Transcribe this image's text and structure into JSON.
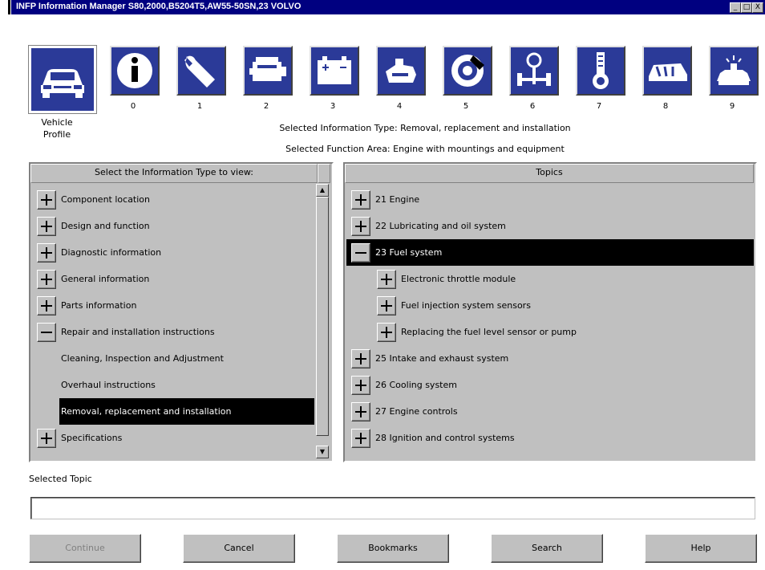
{
  "window": {
    "title": "INFP Information Manager S80,2000,B5204T5,AW55-50SN,23 VOLVO",
    "minimize": "_",
    "maximize": "□",
    "close": "X"
  },
  "icons": [
    {
      "name": "vehicle-profile-icon",
      "number": ""
    },
    {
      "name": "info-icon",
      "number": "0"
    },
    {
      "name": "wrench-icon",
      "number": "1"
    },
    {
      "name": "engine-icon",
      "number": "2"
    },
    {
      "name": "battery-icon",
      "number": "3"
    },
    {
      "name": "transmission-icon",
      "number": "4"
    },
    {
      "name": "brake-disc-icon",
      "number": "5"
    },
    {
      "name": "steering-axle-icon",
      "number": "6"
    },
    {
      "name": "suspension-spring-icon",
      "number": "7"
    },
    {
      "name": "body-interior-icon",
      "number": "8"
    },
    {
      "name": "emergency-vehicle-icon",
      "number": "9"
    }
  ],
  "vehicle_profile_label": "Vehicle Profile",
  "selected_info_type": "Selected Information Type: Removal, replacement and installation",
  "selected_function_area": "Selected Function Area: Engine with mountings and equipment",
  "left_panel": {
    "header": "Select the Information Type to view:",
    "items": [
      {
        "label": "Component location",
        "expander": "plus",
        "indent": 0,
        "selected": false
      },
      {
        "label": "Design and function",
        "expander": "plus",
        "indent": 0,
        "selected": false
      },
      {
        "label": "Diagnostic information",
        "expander": "plus",
        "indent": 0,
        "selected": false
      },
      {
        "label": "General information",
        "expander": "plus",
        "indent": 0,
        "selected": false
      },
      {
        "label": "Parts information",
        "expander": "plus",
        "indent": 0,
        "selected": false
      },
      {
        "label": "Repair and installation instructions",
        "expander": "minus",
        "indent": 0,
        "selected": false
      },
      {
        "label": "Cleaning, Inspection and Adjustment",
        "expander": "none",
        "indent": 1,
        "selected": false
      },
      {
        "label": "Overhaul instructions",
        "expander": "none",
        "indent": 1,
        "selected": false
      },
      {
        "label": "Removal, replacement and installation",
        "expander": "none",
        "indent": 1,
        "selected": true
      },
      {
        "label": "Specifications",
        "expander": "plus",
        "indent": 0,
        "selected": false
      }
    ]
  },
  "right_panel": {
    "header": "Topics",
    "items": [
      {
        "label": "21 Engine",
        "expander": "plus",
        "indent": 0,
        "selected": false
      },
      {
        "label": "22 Lubricating and oil system",
        "expander": "plus",
        "indent": 0,
        "selected": false
      },
      {
        "label": "23 Fuel system",
        "expander": "minus",
        "indent": 0,
        "selected": true
      },
      {
        "label": "Electronic throttle module",
        "expander": "plus",
        "indent": 1,
        "selected": false
      },
      {
        "label": "Fuel injection system sensors",
        "expander": "plus",
        "indent": 1,
        "selected": false
      },
      {
        "label": "Replacing the fuel level sensor or pump",
        "expander": "plus",
        "indent": 1,
        "selected": false
      },
      {
        "label": "25 Intake and exhaust system",
        "expander": "plus",
        "indent": 0,
        "selected": false
      },
      {
        "label": "26 Cooling system",
        "expander": "plus",
        "indent": 0,
        "selected": false
      },
      {
        "label": "27 Engine controls",
        "expander": "plus",
        "indent": 0,
        "selected": false
      },
      {
        "label": "28 Ignition and control systems",
        "expander": "plus",
        "indent": 0,
        "selected": false
      }
    ]
  },
  "selected_topic_label": "Selected Topic",
  "selected_topic_value": "",
  "buttons": [
    {
      "name": "continue-button",
      "label": "Continue",
      "enabled": false
    },
    {
      "name": "cancel-button",
      "label": "Cancel",
      "enabled": true
    },
    {
      "name": "bookmarks-button",
      "label": "Bookmarks",
      "enabled": true
    },
    {
      "name": "search-button",
      "label": "Search",
      "enabled": true
    },
    {
      "name": "help-button",
      "label": "Help",
      "enabled": true
    }
  ],
  "colors": {
    "title_bar": "#000080",
    "icon_tile": "#2b3a98",
    "selection": "#000000",
    "panel": "#c0c0c0"
  }
}
